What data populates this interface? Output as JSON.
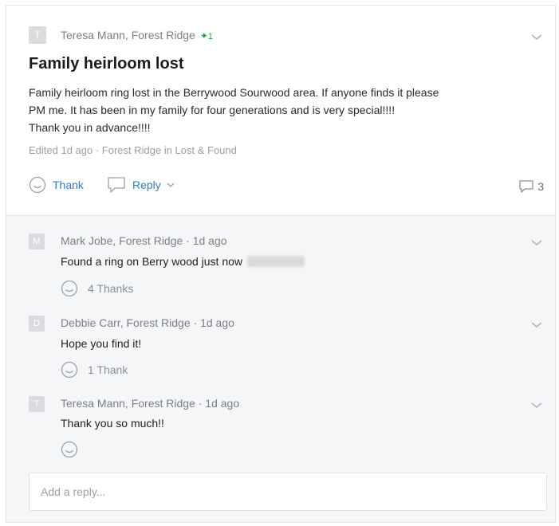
{
  "post": {
    "author": "Teresa Mann, Forest Ridge",
    "avatar_letter": "T",
    "badge_count": "1",
    "title": "Family heirloom lost",
    "body_line1": "Family heirloom ring lost in the Berrywood  Sourwood area. If anyone finds it please",
    "body_line2": "PM me. It has been in my family for four generations and is very special!!!!",
    "body_line3": "Thank you in advance!!!!",
    "meta": "Edited 1d ago · Forest Ridge in Lost & Found",
    "thank_label": "Thank",
    "reply_label": "Reply",
    "reply_count": "3"
  },
  "replies": [
    {
      "author": "Mark Jobe, Forest Ridge · 1d ago",
      "avatar_letter": "M",
      "text": "Found a ring on Berry wood just now",
      "thanks": "4 Thanks"
    },
    {
      "author": "Debbie Carr, Forest Ridge · 1d ago",
      "avatar_letter": "D",
      "text": "Hope you find it!",
      "thanks": "1 Thank"
    },
    {
      "author": "Teresa Mann, Forest Ridge · 1d ago",
      "avatar_letter": "T",
      "text": "Thank you so much!!",
      "thanks": ""
    }
  ],
  "reply_box": {
    "placeholder": "Add a reply..."
  },
  "colors": {
    "link": "#2f7fc1",
    "badge": "#2e9b48",
    "muted": "#9aa0a6",
    "reply_bg": "#f5f6f7"
  }
}
